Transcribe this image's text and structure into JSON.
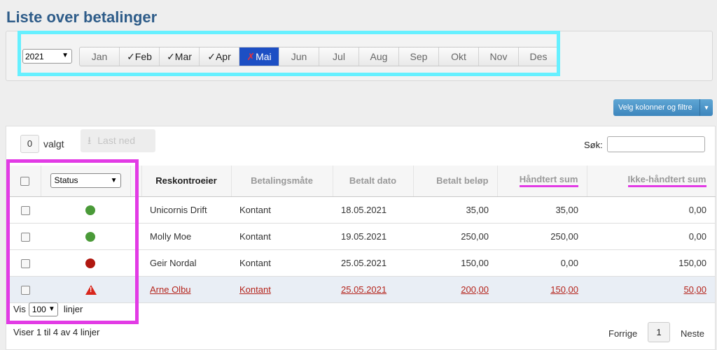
{
  "page_title": "Liste over betalinger",
  "year_select": "2021",
  "months": [
    {
      "label": "Jan",
      "prefix": ""
    },
    {
      "label": "Feb",
      "prefix": "✓"
    },
    {
      "label": "Mar",
      "prefix": "✓"
    },
    {
      "label": "Apr",
      "prefix": "✓"
    },
    {
      "label": "Mai",
      "prefix": "✗"
    },
    {
      "label": "Jun",
      "prefix": ""
    },
    {
      "label": "Jul",
      "prefix": ""
    },
    {
      "label": "Aug",
      "prefix": ""
    },
    {
      "label": "Sep",
      "prefix": ""
    },
    {
      "label": "Okt",
      "prefix": ""
    },
    {
      "label": "Nov",
      "prefix": ""
    },
    {
      "label": "Des",
      "prefix": ""
    }
  ],
  "columns_button": "Velg kolonner og filtre",
  "selected_count": "0",
  "selected_label": "valgt",
  "download_button": "Last ned",
  "search_label": "Søk:",
  "status_filter": "Status",
  "headers": [
    "Reskontroeier",
    "Betalingsmåte",
    "Betalt dato",
    "Betalt beløp",
    "Håndtert sum",
    "Ikke-håndtert sum"
  ],
  "rows": [
    {
      "status": "green",
      "owner": "Unicornis Drift",
      "method": "Kontant",
      "date": "18.05.2021",
      "paid": "35,00",
      "handled": "35,00",
      "unhandled": "0,00"
    },
    {
      "status": "green",
      "owner": "Molly Moe",
      "method": "Kontant",
      "date": "19.05.2021",
      "paid": "250,00",
      "handled": "250,00",
      "unhandled": "0,00"
    },
    {
      "status": "red",
      "owner": "Geir Nordal",
      "method": "Kontant",
      "date": "25.05.2021",
      "paid": "150,00",
      "handled": "0,00",
      "unhandled": "150,00"
    },
    {
      "status": "warning",
      "owner": "Arne Olbu",
      "method": "Kontant",
      "date": "25.05.2021",
      "paid": "200,00",
      "handled": "150,00",
      "unhandled": "50,00"
    }
  ],
  "page_size_prefix": "Vis",
  "page_size": "100",
  "page_size_suffix": "linjer",
  "info_text": "Viser 1 til 4 av 4 linjer",
  "pager": {
    "prev": "Forrige",
    "page": "1",
    "next": "Neste"
  },
  "colors": {
    "title": "#2e5c89",
    "active_month": "#1d4fc4",
    "highlight_cyan": "#66f0ff",
    "highlight_pink": "#e23be5",
    "link_red": "#b5251c"
  }
}
